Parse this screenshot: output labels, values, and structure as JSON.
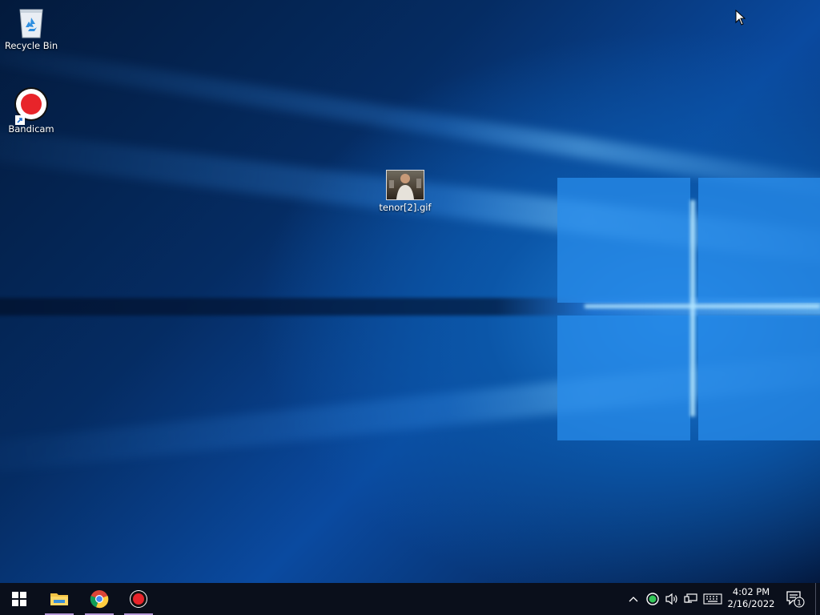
{
  "desktop": {
    "icons": [
      {
        "label": "Recycle Bin",
        "icon": "recycle-bin-icon"
      },
      {
        "label": "Bandicam",
        "icon": "bandicam-icon"
      },
      {
        "label": "tenor[2].gif",
        "icon": "gif-file-icon"
      }
    ]
  },
  "taskbar": {
    "start_icon": "windows-logo-icon",
    "pinned": [
      {
        "name": "File Explorer",
        "icon": "folder-icon",
        "running": true
      },
      {
        "name": "Google Chrome",
        "icon": "chrome-icon",
        "running": false
      },
      {
        "name": "Bandicam",
        "icon": "bandicam-icon",
        "running": true
      }
    ],
    "tray": {
      "icons": [
        "chevron-up-icon",
        "bandicam-tray-icon",
        "volume-icon",
        "network-icon",
        "keyboard-icon"
      ],
      "time": "4:02 PM",
      "date": "2/16/2022",
      "notification_count": "1"
    }
  },
  "colors": {
    "taskbar_bg": "#0a0f1b",
    "desktop_blue": "#0b56a8",
    "running_indicator": "#b69ad8",
    "record_red": "#e8242a"
  }
}
